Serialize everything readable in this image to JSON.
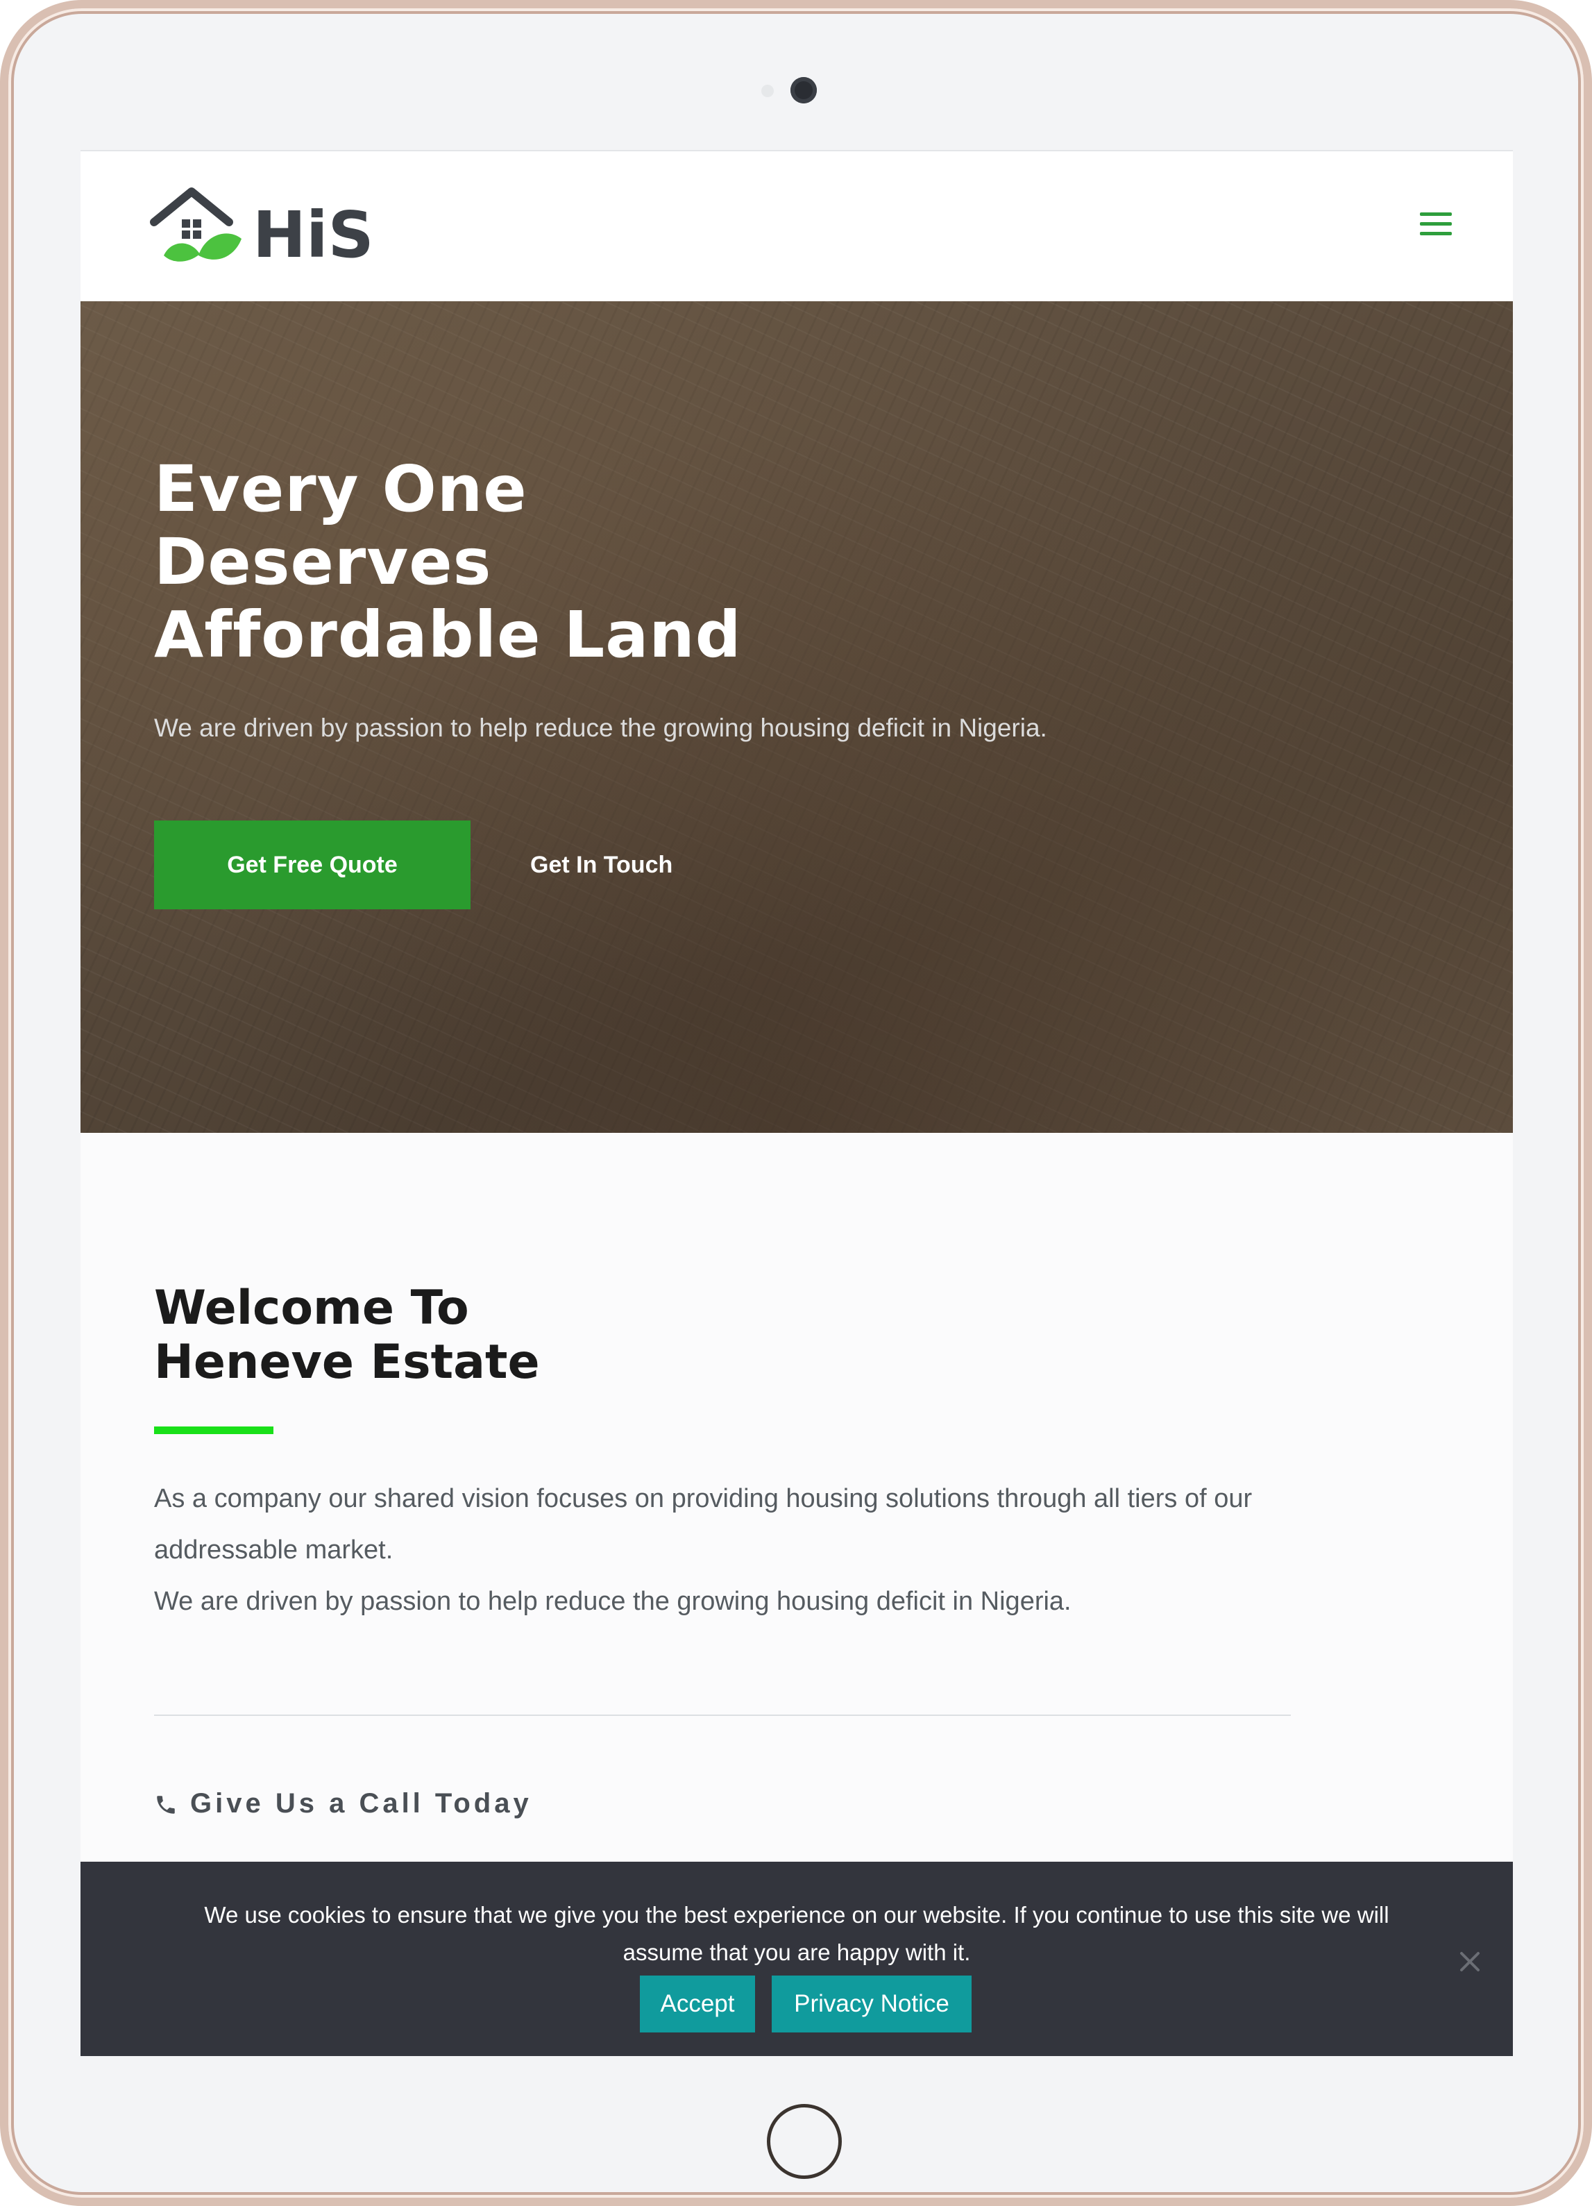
{
  "header": {
    "logo_text": "HiS",
    "menu_icon": "hamburger-menu-icon"
  },
  "hero": {
    "title_lines": [
      "Every One",
      "Deserves",
      "Affordable Land"
    ],
    "subtitle": "We are driven by passion to help reduce the growing housing deficit in Nigeria.",
    "primary_button": "Get Free Quote",
    "secondary_button": "Get In Touch"
  },
  "welcome": {
    "title_lines": [
      "Welcome To",
      "Heneve Estate"
    ],
    "paragraph_1": "As a company our shared vision focuses on providing housing solutions through all tiers of our addressable market.",
    "paragraph_2": "We are driven by passion to help reduce the growing housing deficit in Nigeria.",
    "call_text": "Give Us a Call Today",
    "call_icon": "phone-icon"
  },
  "cookie_notice": {
    "text": "We use cookies to ensure that we give you the best experience on our website. If you continue to use this site we will assume that you are happy with it.",
    "accept_label": "Accept",
    "privacy_label": "Privacy Notice",
    "close_icon": "close-icon"
  },
  "colors": {
    "brand_green": "#2a9b2e",
    "accent_green": "#19e019",
    "logo_dark": "#3d4147",
    "cookie_bg": "#33353d",
    "cookie_button": "#109b9d"
  }
}
